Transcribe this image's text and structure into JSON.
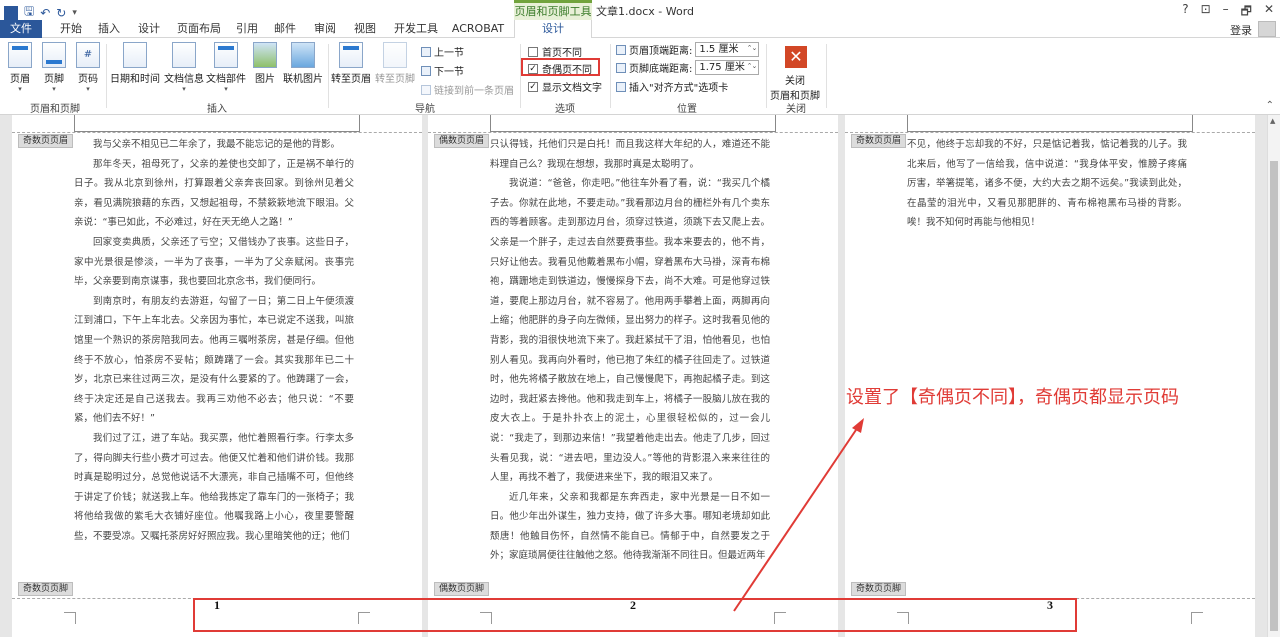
{
  "titlebar": {
    "context_tool": "页眉和页脚工具",
    "doc_title": "文章1.docx - Word",
    "help": "?",
    "ribbon_display": "⊡",
    "minimize": "–",
    "restore": "🗗",
    "close": "✕"
  },
  "tabs": {
    "file": "文件",
    "home": "开始",
    "insert": "插入",
    "design": "设计",
    "layout": "页面布局",
    "references": "引用",
    "mailings": "邮件",
    "review": "审阅",
    "view": "视图",
    "developer": "开发工具",
    "acrobat": "ACROBAT",
    "hf_design": "设计",
    "login": "登录"
  },
  "ribbon": {
    "header": "页眉",
    "footer": "页脚",
    "page_number": "页码",
    "group_hf": "页眉和页脚",
    "datetime": "日期和时间",
    "docinfo": "文档信息",
    "docparts": "文档部件",
    "picture": "图片",
    "online_picture": "联机图片",
    "group_insert": "插入",
    "goto_header": "转至页眉",
    "goto_footer": "转至页脚",
    "prev": "上一节",
    "next": "下一节",
    "link_prev": "链接到前一条页眉",
    "group_nav": "导航",
    "first_page_diff": "首页不同",
    "odd_even_diff": "奇偶页不同",
    "show_doc_text": "显示文档文字",
    "group_options": "选项",
    "header_top_label": "页眉顶端距离:",
    "header_top_value": "1.5 厘米",
    "footer_bottom_label": "页脚底端距离:",
    "footer_bottom_value": "1.75 厘米",
    "insert_align_tab": "插入\"对齐方式\"选项卡",
    "group_position": "位置",
    "close_hf_line1": "关闭",
    "close_hf_line2": "页眉和页脚",
    "group_close": "关闭"
  },
  "pages": [
    {
      "header_tag": "奇数页页眉",
      "footer_tag": "奇数页页脚",
      "page_number": "1",
      "paragraphs": [
        "我与父亲不相见已二年余了，我最不能忘记的是他的背影。",
        "那年冬天，祖母死了，父亲的差使也交卸了，正是祸不单行的日子。我从北京到徐州，打算跟着父亲奔丧回家。到徐州见着父亲，看见满院狼藉的东西，又想起祖母，不禁簌簌地流下眼泪。父亲说：“事已如此，不必难过，好在天无绝人之路！”",
        "回家变卖典质，父亲还了亏空；又借钱办了丧事。这些日子，家中光景很是惨淡，一半为了丧事，一半为了父亲赋闲。丧事完毕，父亲要到南京谋事，我也要回北京念书，我们便同行。",
        "到南京时，有朋友约去游逛，勾留了一日；第二日上午便须渡江到浦口，下午上车北去。父亲因为事忙，本已说定不送我，叫旅馆里一个熟识的茶房陪我同去。他再三嘱咐茶房，甚是仔细。但他终于不放心，怕茶房不妥帖；颇踌躇了一会。其实我那年已二十岁，北京已来往过两三次，是没有什么要紧的了。他踌躇了一会，终于决定还是自己送我去。我再三劝他不必去；他只说：“不要紧，他们去不好！”",
        "我们过了江，进了车站。我买票，他忙着照看行李。行李太多了，得向脚夫行些小费才可过去。他便又忙着和他们讲价钱。我那时真是聪明过分，总觉他说话不大漂亮，非自己插嘴不可，但他终于讲定了价钱；就送我上车。他给我拣定了靠车门的一张椅子；我将他给我做的紫毛大衣铺好座位。他嘱我路上小心，夜里要警醒些，不要受凉。又嘱托茶房好好照应我。我心里暗笑他的迂；他们"
      ]
    },
    {
      "header_tag": "偶数页页眉",
      "footer_tag": "偶数页页脚",
      "page_number": "2",
      "paragraphs": [
        "只认得钱，托他们只是白托！而且我这样大年纪的人，难道还不能料理自己么？我现在想想，我那时真是太聪明了。",
        "我说道：“爸爸，你走吧。”他往车外看了看，说：“我买几个橘子去。你就在此地，不要走动。”我看那边月台的栅栏外有几个卖东西的等着顾客。走到那边月台，须穿过铁道，须跳下去又爬上去。父亲是一个胖子，走过去自然要费事些。我本来要去的，他不肯，只好让他去。我看见他戴着黑布小帽，穿着黑布大马褂，深青布棉袍，蹒跚地走到铁道边，慢慢探身下去，尚不大难。可是他穿过铁道，要爬上那边月台，就不容易了。他用两手攀着上面，两脚再向上缩；他肥胖的身子向左微倾，显出努力的样子。这时我看见他的背影，我的泪很快地流下来了。我赶紧拭干了泪，怕他看见，也怕别人看见。我再向外看时，他已抱了朱红的橘子往回走了。过铁道时，他先将橘子散放在地上，自己慢慢爬下，再抱起橘子走。到这边时，我赶紧去搀他。他和我走到车上，将橘子一股脑儿放在我的皮大衣上。于是扑扑衣上的泥土，心里很轻松似的，过一会儿说：“我走了，到那边来信！”我望着他走出去。他走了几步，回过头看见我，说：“进去吧，里边没人。”等他的背影混入来来往往的人里，再找不着了，我便进来坐下，我的眼泪又来了。",
        "近几年来，父亲和我都是东奔西走，家中光景是一日不如一日。他少年出外谋生，独力支持，做了许多大事。哪知老境却如此颓唐！他触目伤怀，自然情不能自已。情郁于中，自然要发之于外；家庭琐屑便往往触他之怒。他待我渐渐不同往日。但最近两年"
      ]
    },
    {
      "header_tag": "奇数页页眉",
      "footer_tag": "奇数页页脚",
      "page_number": "3",
      "paragraphs": [
        "不见，他终于忘却我的不好，只是惦记着我，惦记着我的儿子。我北来后，他写了一信给我，信中说道：“我身体平安，惟膀子疼痛厉害，举箸提笔，诸多不便，大约大去之期不远矣。”我读到此处，在晶莹的泪光中，又看见那肥胖的、青布棉袍黑布马褂的背影。唉！我不知何时再能与他相见！"
      ]
    }
  ],
  "annotation": "设置了【奇偶页不同】，奇偶页都显示页码",
  "colors": {
    "brand": "#2b579a",
    "context_green": "#71a33c",
    "highlight_red": "#e03b36"
  }
}
